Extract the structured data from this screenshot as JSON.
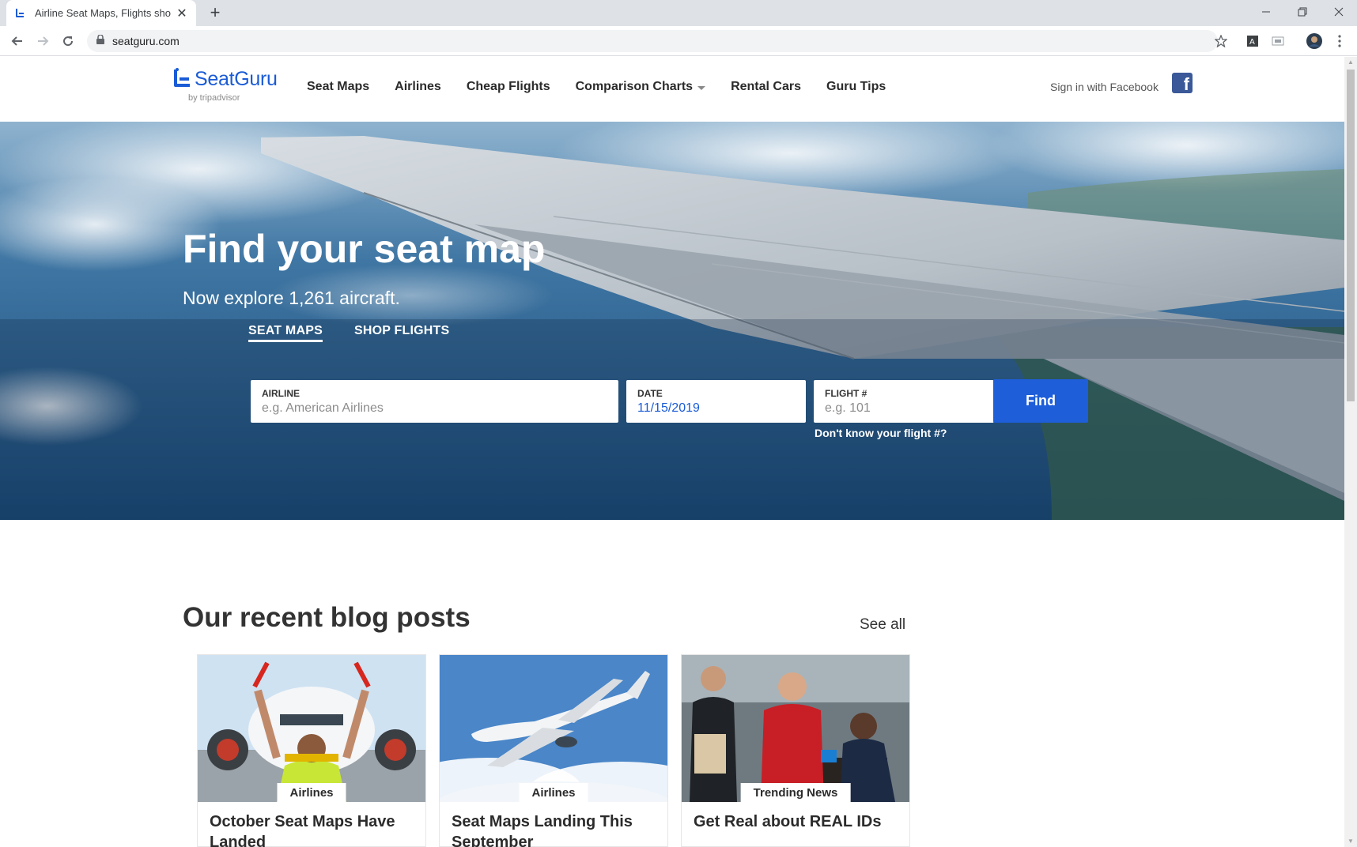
{
  "browser": {
    "tab_title": "Airline Seat Maps, Flights shopping",
    "new_tab": "+",
    "url": "seatguru.com",
    "window_controls": [
      "minimize",
      "restore",
      "close"
    ]
  },
  "header": {
    "logo": "SeatGuru",
    "logo_sub": "by tripadvisor",
    "nav": [
      "Seat Maps",
      "Airlines",
      "Cheap Flights",
      "Comparison Charts",
      "Rental Cars",
      "Guru Tips"
    ],
    "signin": "Sign in with Facebook",
    "facebook_glyph": "f"
  },
  "hero": {
    "title": "Find your seat map",
    "subtitle": "Now explore 1,261 aircraft.",
    "tabs": [
      "SEAT MAPS",
      "SHOP FLIGHTS"
    ],
    "active_tab": "SEAT MAPS",
    "airline_label": "AIRLINE",
    "airline_placeholder": "e.g. American Airlines",
    "date_label": "DATE",
    "date_value": "11/15/2019",
    "flight_label": "FLIGHT #",
    "flight_placeholder": "e.g. 101",
    "find_button": "Find",
    "dont_know": "Don't know your flight #?"
  },
  "blog": {
    "title": "Our recent blog posts",
    "see_all": "See all",
    "posts": [
      {
        "category": "Airlines",
        "title": "October Seat Maps Have Landed"
      },
      {
        "category": "Airlines",
        "title": "Seat Maps Landing This September"
      },
      {
        "category": "Trending News",
        "title": "Get Real about REAL IDs"
      }
    ]
  },
  "colors": {
    "brand_blue": "#1a5bd6",
    "button_blue": "#1e5ed9",
    "facebook": "#3b5998"
  }
}
